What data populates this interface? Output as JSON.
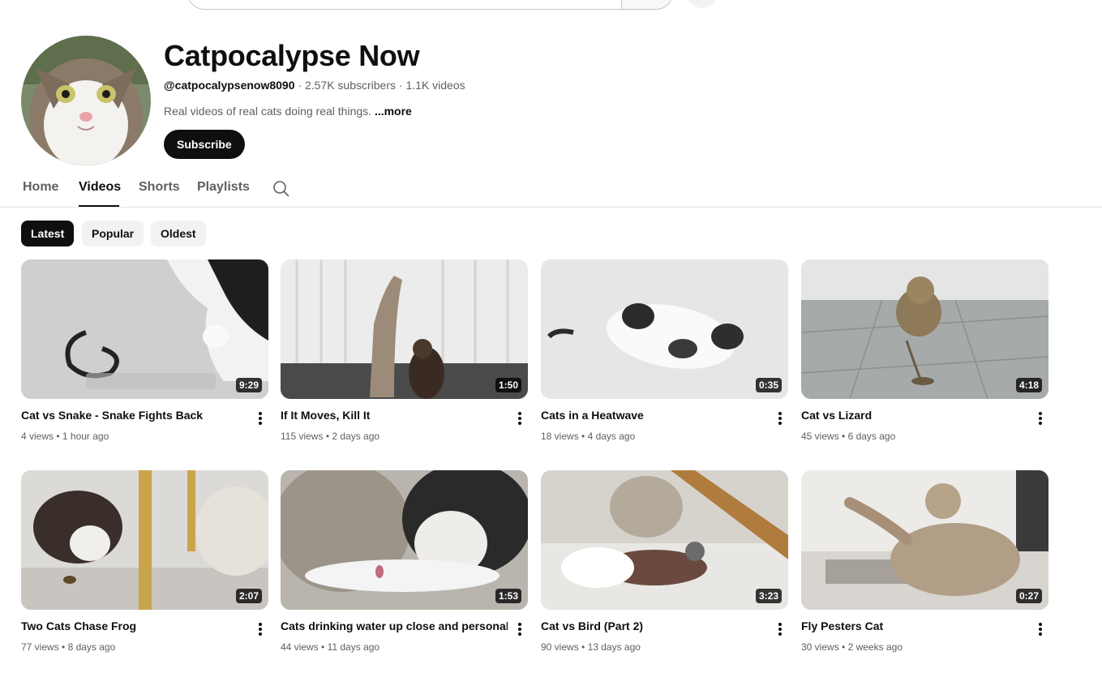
{
  "channel": {
    "name": "Catpocalypse Now",
    "handle": "@catpocalypsenow8090",
    "subscribers": "2.57K subscribers",
    "video_count": "1.1K videos",
    "separator": " · ",
    "description": "Real videos of real cats doing real things.",
    "more_label": "...more",
    "subscribe_label": "Subscribe"
  },
  "tabs": [
    {
      "label": "Home"
    },
    {
      "label": "Videos",
      "active": true
    },
    {
      "label": "Shorts"
    },
    {
      "label": "Playlists"
    }
  ],
  "chips": [
    {
      "label": "Latest",
      "selected": true
    },
    {
      "label": "Popular"
    },
    {
      "label": "Oldest"
    }
  ],
  "meta_dot": " • ",
  "videos": [
    {
      "title": "Cat vs Snake - Snake Fights Back",
      "views": "4 views",
      "age": "1 hour ago",
      "duration": "9:29"
    },
    {
      "title": "If It Moves, Kill It",
      "views": "115 views",
      "age": "2 days ago",
      "duration": "1:50"
    },
    {
      "title": "Cats in a Heatwave",
      "views": "18 views",
      "age": "4 days ago",
      "duration": "0:35"
    },
    {
      "title": "Cat vs Lizard",
      "views": "45 views",
      "age": "6 days ago",
      "duration": "4:18"
    },
    {
      "title": "Two Cats Chase Frog",
      "views": "77 views",
      "age": "8 days ago",
      "duration": "2:07"
    },
    {
      "title": "Cats drinking water up close and personal",
      "views": "44 views",
      "age": "11 days ago",
      "duration": "1:53"
    },
    {
      "title": "Cat vs Bird (Part 2)",
      "views": "90 views",
      "age": "13 days ago",
      "duration": "3:23"
    },
    {
      "title": "Fly Pesters Cat",
      "views": "30 views",
      "age": "2 weeks ago",
      "duration": "0:27"
    }
  ],
  "icons": {
    "search": "search-icon",
    "more": "more-vertical-icon"
  },
  "colors": {
    "text_primary": "#0f0f0f",
    "text_secondary": "#606060",
    "chip_bg": "#f2f2f2"
  }
}
